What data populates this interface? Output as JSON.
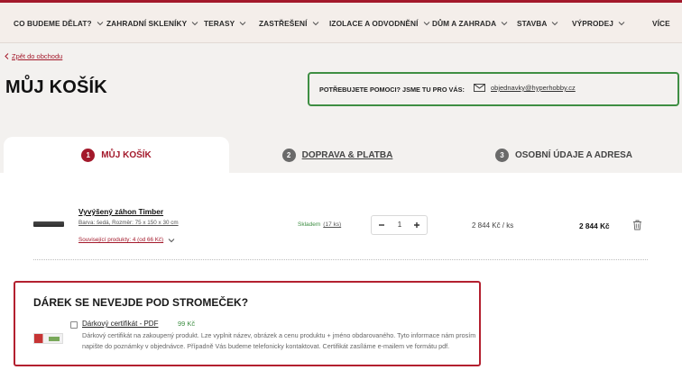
{
  "nav": {
    "items": [
      {
        "label": "CO BUDEME DĚLAT?"
      },
      {
        "label": "ZAHRADNÍ SKLENÍKY"
      },
      {
        "label": "TERASY"
      },
      {
        "label": "ZASTŘEŠENÍ"
      },
      {
        "label": "IZOLACE A ODVODNĚNÍ"
      },
      {
        "label": "DŮM A ZAHRADA"
      },
      {
        "label": "STAVBA"
      },
      {
        "label": "VÝPRODEJ"
      }
    ],
    "more_label": "VÍCE"
  },
  "back_link": "Zpět do obchodu",
  "page_title": "MŮJ KOŠÍK",
  "help": {
    "text": "POTŘEBUJETE POMOCI? JSME TU PRO VÁS:",
    "email": "objednavky@hyperhobby.cz"
  },
  "steps": [
    {
      "num": "1",
      "label": "MŮJ KOŠÍK",
      "active": true
    },
    {
      "num": "2",
      "label": "DOPRAVA & PLATBA",
      "active": false
    },
    {
      "num": "3",
      "label": "OSOBNÍ ÚDAJE A ADRESA",
      "active": false
    }
  ],
  "cart_item": {
    "name": "Vyvýšený záhon Timber",
    "attributes": "Barva: šedá, Rozměr: 75 x 150 x 30 cm",
    "related": "Související produkty: 4 (od 66 Kč)",
    "stock_label": "Skladem",
    "stock_count": "(17 ks)",
    "quantity": "1",
    "unit_price": "2 844 Kč  / ks",
    "total_price": "2 844 Kč"
  },
  "gift": {
    "title": "DÁREK SE NEVEJDE POD STROMEČEK?",
    "product_name": "Dárkový certifikát - PDF",
    "product_price": "99 Kč",
    "description": "Dárkový certifikát na zakoupený produkt. Lze vyplnit název, obrázek a cenu produktu + jméno obdarovaného. Tyto informace nám prosím napište do poznámky v objednávce. Případně Vás budeme telefonicky kontaktovat. Certifikát zasíláme e-mailem ve formátu pdf."
  },
  "colors": {
    "brand": "#a3192b",
    "accent_green": "#3e8e43",
    "background": "#f3f1ef"
  },
  "icons": {
    "chevron": "chevron-down-icon",
    "back": "chevron-left-icon",
    "mail": "mail-icon",
    "trash": "trash-icon"
  }
}
